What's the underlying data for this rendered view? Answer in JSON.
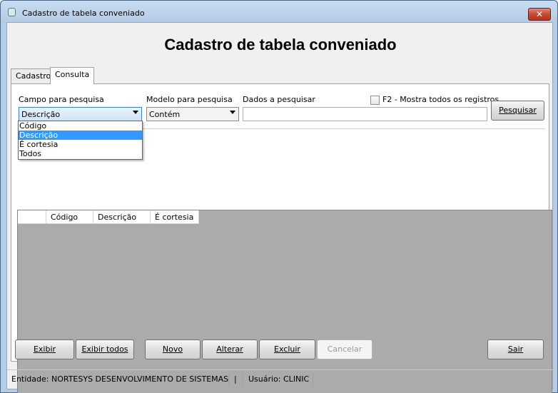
{
  "window": {
    "title": "Cadastro de tabela conveniado",
    "close_label": "✕"
  },
  "heading": "Cadastro de tabela conveniado",
  "tabs": [
    {
      "label": "Cadastro"
    },
    {
      "label": "Consulta"
    }
  ],
  "search": {
    "campo_label": "Campo para pesquisa",
    "campo_value": "Descrição",
    "modelo_label": "Modelo para pesquisa",
    "modelo_value": "Contém",
    "dados_label": "Dados a pesquisar",
    "dados_value": "",
    "f2_label": "F2 - Mostra todos os registros",
    "pesquisar_label": "Pesquisar"
  },
  "dropdown": {
    "options": [
      "Código",
      "Descrição",
      "É cortesia",
      "Todos"
    ],
    "selected": "Descrição"
  },
  "grid": {
    "columns": [
      "Código",
      "Descrição",
      "É cortesia"
    ]
  },
  "buttons": {
    "exibir": "Exibir",
    "exibir_todos": "Exibir todos",
    "novo": "Novo",
    "alterar": "Alterar",
    "excluir": "Excluir",
    "cancelar": "Cancelar",
    "sair": "Sair"
  },
  "status": {
    "entidade": "Entidade: NORTESYS DESENVOLVIMENTO DE SISTEMAS",
    "separator": "|",
    "usuario": "Usuário: CLINIC"
  }
}
